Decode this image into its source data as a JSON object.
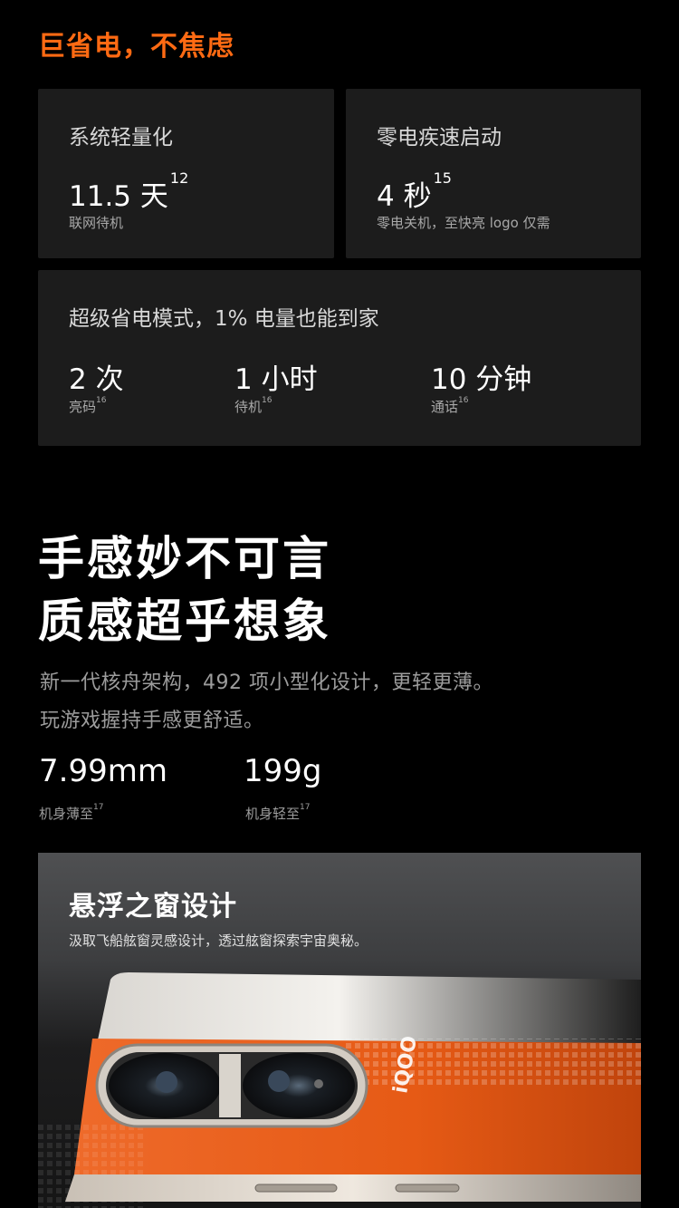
{
  "battery": {
    "heading": "巨省电，不焦虑",
    "card1": {
      "title": "系统轻量化",
      "value": "11.5 天",
      "sup": "12",
      "note": "联网待机"
    },
    "card2": {
      "title": "零电疾速启动",
      "value": "4 秒",
      "sup": "15",
      "note": "零电关机，至快亮 logo 仅需"
    },
    "card3": {
      "title": "超级省电模式，1% 电量也能到家",
      "items": [
        {
          "value": "2 次",
          "note": "亮码",
          "sup": "16"
        },
        {
          "value": "1 小时",
          "note": "待机",
          "sup": "16"
        },
        {
          "value": "10 分钟",
          "note": "通话",
          "sup": "16"
        }
      ]
    }
  },
  "feel": {
    "title_line1": "手感妙不可言",
    "title_line2": "质感超乎想象",
    "desc_line1": "新一代核舟架构，492 项小型化设计，更轻更薄。",
    "desc_line2": "玩游戏握持手感更舒适。",
    "specs": [
      {
        "value": "7.99mm",
        "note": "机身薄至",
        "sup": "17"
      },
      {
        "value": "199g",
        "note": "机身轻至",
        "sup": "17"
      }
    ]
  },
  "promo": {
    "title": "悬浮之窗设计",
    "subtitle": "汲取飞船舷窗灵感设计，透过舷窗探索宇宙奥秘。"
  },
  "colors": {
    "accent": "#ff6a13",
    "card_bg": "#1c1c1c",
    "phone_orange": "#e85a16"
  }
}
